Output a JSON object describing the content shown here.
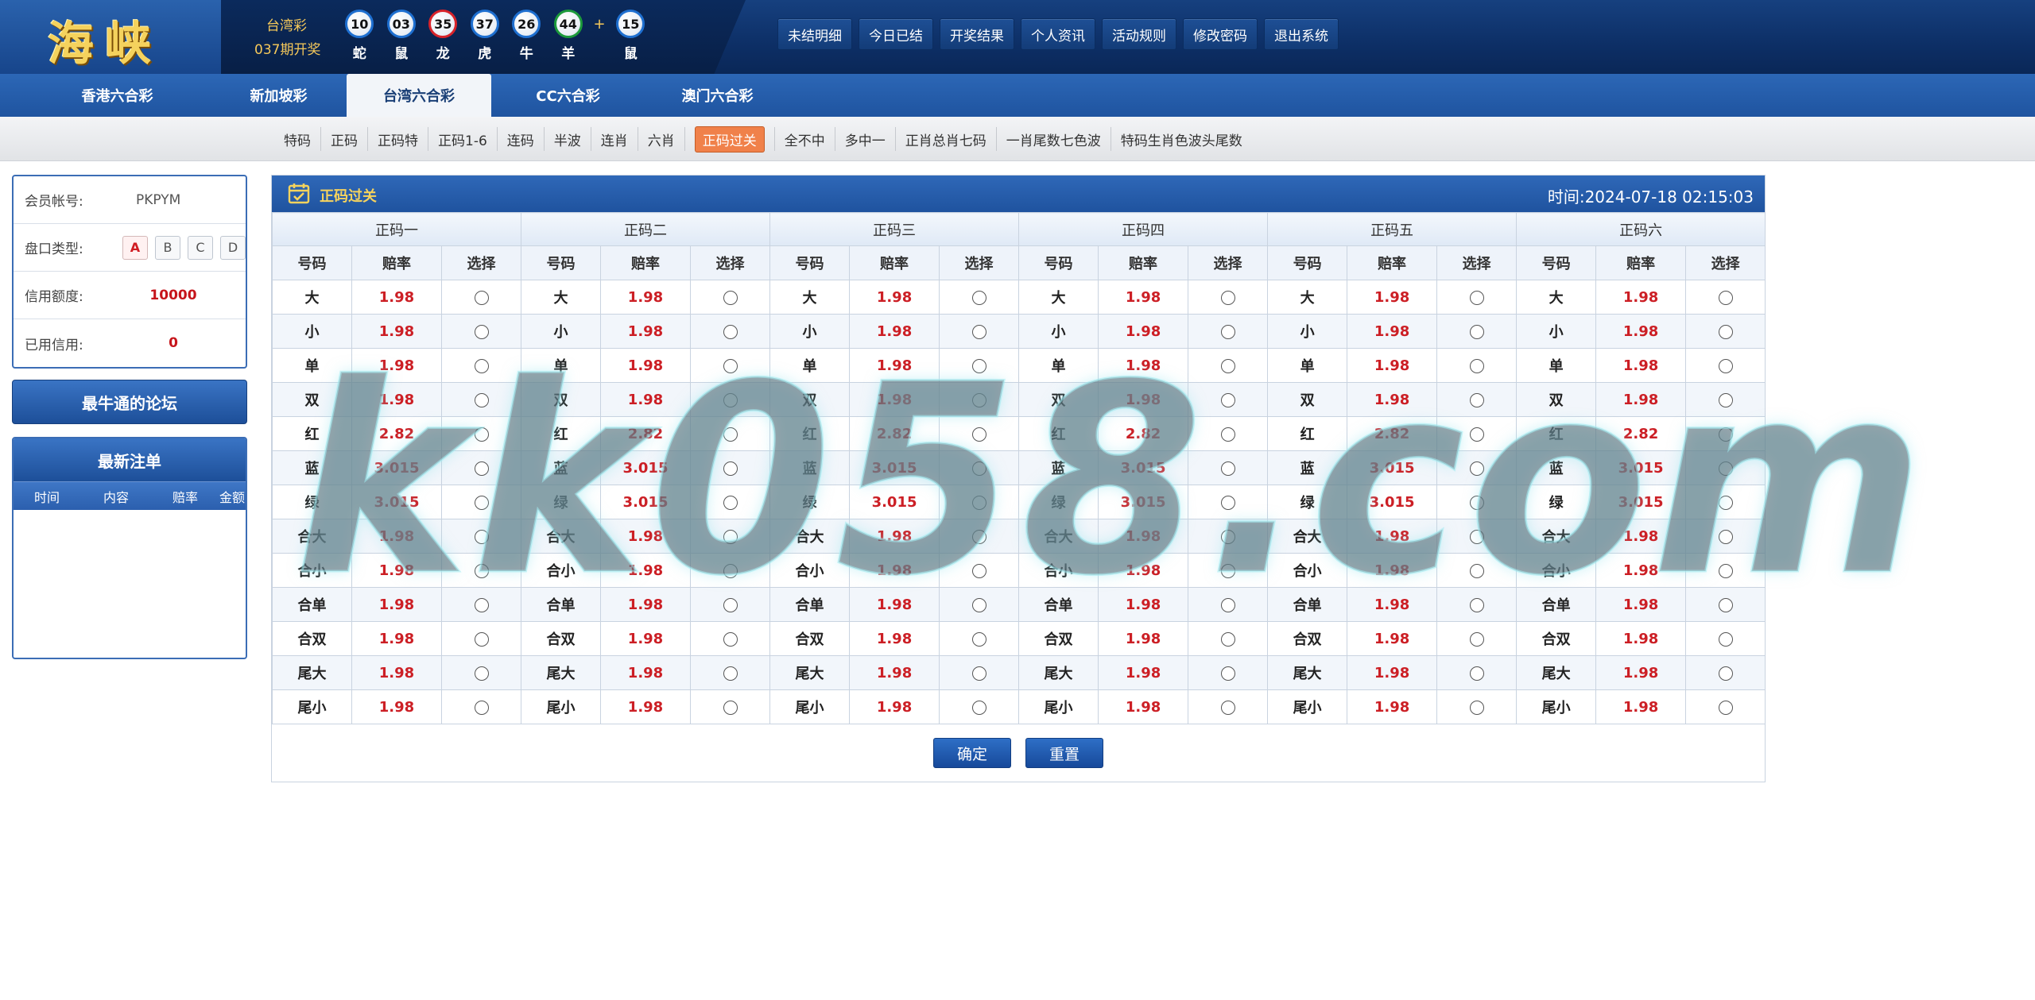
{
  "header": {
    "logo": "海峡",
    "lottery_name": "台湾彩",
    "issue": "037期开奖",
    "balls": [
      {
        "num": "10",
        "zodiac": "蛇",
        "color": "blue"
      },
      {
        "num": "03",
        "zodiac": "鼠",
        "color": "blue"
      },
      {
        "num": "35",
        "zodiac": "龙",
        "color": "red"
      },
      {
        "num": "37",
        "zodiac": "虎",
        "color": "blue"
      },
      {
        "num": "26",
        "zodiac": "牛",
        "color": "blue"
      },
      {
        "num": "44",
        "zodiac": "羊",
        "color": "green"
      }
    ],
    "plus": "+",
    "special_ball": {
      "num": "15",
      "zodiac": "鼠",
      "color": "blue"
    },
    "nav": [
      "未结明细",
      "今日已结",
      "开奖结果",
      "个人资讯",
      "活动规则",
      "修改密码",
      "退出系统"
    ]
  },
  "lottery_tabs": [
    "香港六合彩",
    "新加坡彩",
    "台湾六合彩",
    "CC六合彩",
    "澳门六合彩"
  ],
  "active_lottery_tab": 2,
  "subnav": [
    "特码",
    "正码",
    "正码特",
    "正码1-6",
    "连码",
    "半波",
    "连肖",
    "六肖",
    "正码过关",
    "全不中",
    "多中一",
    "正肖总肖七码",
    "一肖尾数七色波",
    "特码生肖色波头尾数"
  ],
  "active_subnav": 8,
  "member": {
    "account_label": "会员帐号:",
    "account": "PKPYM",
    "pan_label": "盘口类型:",
    "pans": [
      "A",
      "B",
      "C",
      "D"
    ],
    "selected_pan": "A",
    "credit_label": "信用额度:",
    "credit": "10000",
    "used_label": "已用信用:",
    "used": "0"
  },
  "forum_button": "最牛通的论坛",
  "latest": {
    "title": "最新注单",
    "columns": [
      "时间",
      "内容",
      "赔率",
      "金额"
    ]
  },
  "main": {
    "title": "正码过关",
    "time": "时间:2024-07-18 02:15:03",
    "groups": [
      "正码一",
      "正码二",
      "正码三",
      "正码四",
      "正码五",
      "正码六"
    ],
    "col_headers": [
      "号码",
      "赔率",
      "选择"
    ],
    "rows": [
      {
        "code": "大",
        "odds": "1.98"
      },
      {
        "code": "小",
        "odds": "1.98"
      },
      {
        "code": "单",
        "odds": "1.98"
      },
      {
        "code": "双",
        "odds": "1.98"
      },
      {
        "code": "红",
        "odds": "2.82"
      },
      {
        "code": "蓝",
        "odds": "3.015"
      },
      {
        "code": "绿",
        "odds": "3.015"
      },
      {
        "code": "合大",
        "odds": "1.98"
      },
      {
        "code": "合小",
        "odds": "1.98"
      },
      {
        "code": "合单",
        "odds": "1.98"
      },
      {
        "code": "合双",
        "odds": "1.98"
      },
      {
        "code": "尾大",
        "odds": "1.98"
      },
      {
        "code": "尾小",
        "odds": "1.98"
      }
    ],
    "confirm": "确定",
    "reset": "重置"
  },
  "watermark": "kk058.com",
  "colors": {
    "accent": "#1f539f",
    "odds": "#cc1f25",
    "active_sub": "#f0814a",
    "gold": "#f6d35d"
  }
}
